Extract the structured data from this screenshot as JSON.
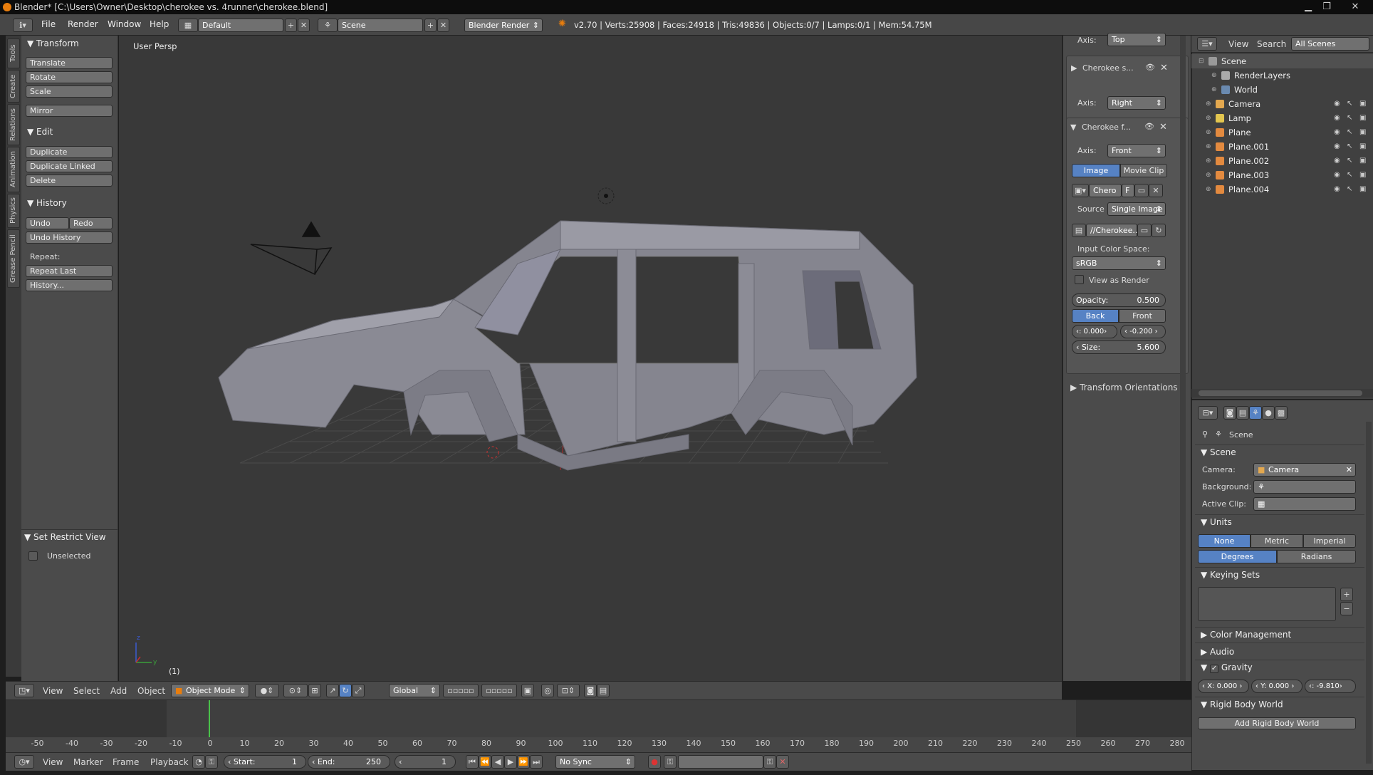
{
  "title_bar": {
    "text": "Blender* [C:\\Users\\Owner\\Desktop\\cherokee vs. 4runner\\cherokee.blend]"
  },
  "info_header": {
    "menus": [
      "File",
      "Render",
      "Window",
      "Help"
    ],
    "layout": "Default",
    "scene": "Scene",
    "engine": "Blender Render",
    "stats": "v2.70 | Verts:25908 | Faces:24918 | Tris:49836 | Objects:0/7 | Lamps:0/1 | Mem:54.75M"
  },
  "tool_tabs": [
    "Tools",
    "Create",
    "Relations",
    "Animation",
    "Physics",
    "Grease Pencil"
  ],
  "tool_shelf": {
    "transform": {
      "header": "Transform",
      "buttons": [
        "Translate",
        "Rotate",
        "Scale",
        "Mirror"
      ]
    },
    "edit": {
      "header": "Edit",
      "buttons": [
        "Duplicate",
        "Duplicate Linked",
        "Delete"
      ]
    },
    "history": {
      "header": "History",
      "undo": "Undo",
      "redo": "Redo",
      "undo_history": "Undo History",
      "repeat_label": "Repeat:",
      "repeat_last": "Repeat Last",
      "history": "History..."
    },
    "restrict": {
      "header": "Set Restrict View",
      "unselected": "Unselected"
    }
  },
  "viewport": {
    "view_label": "User Persp",
    "frame_label": "(1)"
  },
  "viewport_header": {
    "menus": [
      "View",
      "Select",
      "Add",
      "Object"
    ],
    "mode": "Object Mode",
    "orientation": "Global"
  },
  "n_panel": {
    "axis_label": "Axis:",
    "top_axis": "Top",
    "bg1": {
      "name": "Cherokee s...",
      "axis": "Right"
    },
    "bg2": {
      "name": "Cherokee f...",
      "axis": "Front"
    },
    "source_tabs": [
      "Image",
      "Movie Clip"
    ],
    "image_name": "Chero",
    "image_f": "F",
    "source_label": "Source",
    "source_value": "Single Image",
    "filepath": "//Cherokee...",
    "input_color_label": "Input Color Space:",
    "color_space": "sRGB",
    "view_as_render": "View as Render",
    "opacity_label": "Opacity:",
    "opacity_value": "0.500",
    "depth": [
      "Back",
      "Front"
    ],
    "x_value": ": 0.000",
    "y_value": "-0.200",
    "size_label": "Size:",
    "size_value": "5.600",
    "transform_orient": "Transform Orientations"
  },
  "outliner": {
    "view": "View",
    "search": "Search",
    "filter": "All Scenes",
    "items": [
      {
        "name": "Scene",
        "icon_color": "#9a9a9a"
      },
      {
        "name": "RenderLayers",
        "icon_color": "#aaaaaa"
      },
      {
        "name": "World",
        "icon_color": "#6a8ab0"
      },
      {
        "name": "Camera",
        "icon_color": "#e3a84f"
      },
      {
        "name": "Lamp",
        "icon_color": "#e3c64f"
      },
      {
        "name": "Plane",
        "icon_color": "#e38a3f"
      },
      {
        "name": "Plane.001",
        "icon_color": "#e38a3f"
      },
      {
        "name": "Plane.002",
        "icon_color": "#e38a3f"
      },
      {
        "name": "Plane.003",
        "icon_color": "#e38a3f"
      },
      {
        "name": "Plane.004",
        "icon_color": "#e38a3f"
      }
    ]
  },
  "properties": {
    "breadcrumb": "Scene",
    "scene_header": "Scene",
    "camera_label": "Camera:",
    "camera_value": "Camera",
    "background_label": "Background:",
    "active_clip_label": "Active Clip:",
    "units_header": "Units",
    "units": [
      "None",
      "Metric",
      "Imperial"
    ],
    "angles": [
      "Degrees",
      "Radians"
    ],
    "keying_header": "Keying Sets",
    "color_mgmt": "Color Management",
    "audio": "Audio",
    "gravity": "Gravity",
    "gx": "X: 0.000",
    "gy": "Y: 0.000",
    "gz": ": -9.810",
    "rigid_header": "Rigid Body World",
    "add_rigid": "Add Rigid Body World"
  },
  "timeline": {
    "ticks": [
      "-50",
      "-40",
      "-30",
      "-20",
      "-10",
      "0",
      "10",
      "20",
      "30",
      "40",
      "50",
      "60",
      "70",
      "80",
      "90",
      "100",
      "110",
      "120",
      "130",
      "140",
      "150",
      "160",
      "170",
      "180",
      "190",
      "200",
      "210",
      "220",
      "230",
      "240",
      "250",
      "260",
      "270",
      "280"
    ],
    "menus": [
      "View",
      "Marker",
      "Frame",
      "Playback"
    ],
    "start_label": "Start:",
    "start_value": "1",
    "end_label": "End:",
    "end_value": "250",
    "current": "1",
    "sync": "No Sync"
  },
  "colors": {
    "accent": "#5682c4",
    "header": "#474747",
    "panel": "#4b4b4b",
    "viewport": "#393939"
  }
}
